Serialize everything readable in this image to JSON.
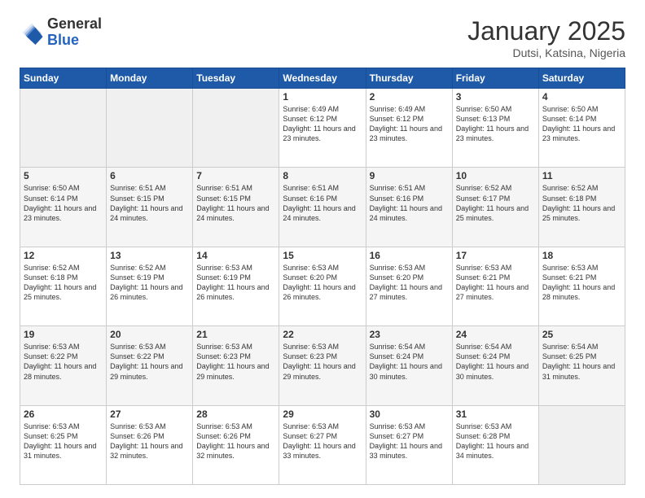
{
  "header": {
    "logo_general": "General",
    "logo_blue": "Blue",
    "month_title": "January 2025",
    "location": "Dutsi, Katsina, Nigeria"
  },
  "calendar": {
    "days_of_week": [
      "Sunday",
      "Monday",
      "Tuesday",
      "Wednesday",
      "Thursday",
      "Friday",
      "Saturday"
    ],
    "weeks": [
      [
        {
          "day": "",
          "empty": true
        },
        {
          "day": "",
          "empty": true
        },
        {
          "day": "",
          "empty": true
        },
        {
          "day": "1",
          "sunrise": "6:49 AM",
          "sunset": "6:12 PM",
          "daylight": "11 hours and 23 minutes."
        },
        {
          "day": "2",
          "sunrise": "6:49 AM",
          "sunset": "6:12 PM",
          "daylight": "11 hours and 23 minutes."
        },
        {
          "day": "3",
          "sunrise": "6:50 AM",
          "sunset": "6:13 PM",
          "daylight": "11 hours and 23 minutes."
        },
        {
          "day": "4",
          "sunrise": "6:50 AM",
          "sunset": "6:14 PM",
          "daylight": "11 hours and 23 minutes."
        }
      ],
      [
        {
          "day": "5",
          "sunrise": "6:50 AM",
          "sunset": "6:14 PM",
          "daylight": "11 hours and 23 minutes."
        },
        {
          "day": "6",
          "sunrise": "6:51 AM",
          "sunset": "6:15 PM",
          "daylight": "11 hours and 24 minutes."
        },
        {
          "day": "7",
          "sunrise": "6:51 AM",
          "sunset": "6:15 PM",
          "daylight": "11 hours and 24 minutes."
        },
        {
          "day": "8",
          "sunrise": "6:51 AM",
          "sunset": "6:16 PM",
          "daylight": "11 hours and 24 minutes."
        },
        {
          "day": "9",
          "sunrise": "6:51 AM",
          "sunset": "6:16 PM",
          "daylight": "11 hours and 24 minutes."
        },
        {
          "day": "10",
          "sunrise": "6:52 AM",
          "sunset": "6:17 PM",
          "daylight": "11 hours and 25 minutes."
        },
        {
          "day": "11",
          "sunrise": "6:52 AM",
          "sunset": "6:18 PM",
          "daylight": "11 hours and 25 minutes."
        }
      ],
      [
        {
          "day": "12",
          "sunrise": "6:52 AM",
          "sunset": "6:18 PM",
          "daylight": "11 hours and 25 minutes."
        },
        {
          "day": "13",
          "sunrise": "6:52 AM",
          "sunset": "6:19 PM",
          "daylight": "11 hours and 26 minutes."
        },
        {
          "day": "14",
          "sunrise": "6:53 AM",
          "sunset": "6:19 PM",
          "daylight": "11 hours and 26 minutes."
        },
        {
          "day": "15",
          "sunrise": "6:53 AM",
          "sunset": "6:20 PM",
          "daylight": "11 hours and 26 minutes."
        },
        {
          "day": "16",
          "sunrise": "6:53 AM",
          "sunset": "6:20 PM",
          "daylight": "11 hours and 27 minutes."
        },
        {
          "day": "17",
          "sunrise": "6:53 AM",
          "sunset": "6:21 PM",
          "daylight": "11 hours and 27 minutes."
        },
        {
          "day": "18",
          "sunrise": "6:53 AM",
          "sunset": "6:21 PM",
          "daylight": "11 hours and 28 minutes."
        }
      ],
      [
        {
          "day": "19",
          "sunrise": "6:53 AM",
          "sunset": "6:22 PM",
          "daylight": "11 hours and 28 minutes."
        },
        {
          "day": "20",
          "sunrise": "6:53 AM",
          "sunset": "6:22 PM",
          "daylight": "11 hours and 29 minutes."
        },
        {
          "day": "21",
          "sunrise": "6:53 AM",
          "sunset": "6:23 PM",
          "daylight": "11 hours and 29 minutes."
        },
        {
          "day": "22",
          "sunrise": "6:53 AM",
          "sunset": "6:23 PM",
          "daylight": "11 hours and 29 minutes."
        },
        {
          "day": "23",
          "sunrise": "6:54 AM",
          "sunset": "6:24 PM",
          "daylight": "11 hours and 30 minutes."
        },
        {
          "day": "24",
          "sunrise": "6:54 AM",
          "sunset": "6:24 PM",
          "daylight": "11 hours and 30 minutes."
        },
        {
          "day": "25",
          "sunrise": "6:54 AM",
          "sunset": "6:25 PM",
          "daylight": "11 hours and 31 minutes."
        }
      ],
      [
        {
          "day": "26",
          "sunrise": "6:53 AM",
          "sunset": "6:25 PM",
          "daylight": "11 hours and 31 minutes."
        },
        {
          "day": "27",
          "sunrise": "6:53 AM",
          "sunset": "6:26 PM",
          "daylight": "11 hours and 32 minutes."
        },
        {
          "day": "28",
          "sunrise": "6:53 AM",
          "sunset": "6:26 PM",
          "daylight": "11 hours and 32 minutes."
        },
        {
          "day": "29",
          "sunrise": "6:53 AM",
          "sunset": "6:27 PM",
          "daylight": "11 hours and 33 minutes."
        },
        {
          "day": "30",
          "sunrise": "6:53 AM",
          "sunset": "6:27 PM",
          "daylight": "11 hours and 33 minutes."
        },
        {
          "day": "31",
          "sunrise": "6:53 AM",
          "sunset": "6:28 PM",
          "daylight": "11 hours and 34 minutes."
        },
        {
          "day": "",
          "empty": true
        }
      ]
    ]
  }
}
